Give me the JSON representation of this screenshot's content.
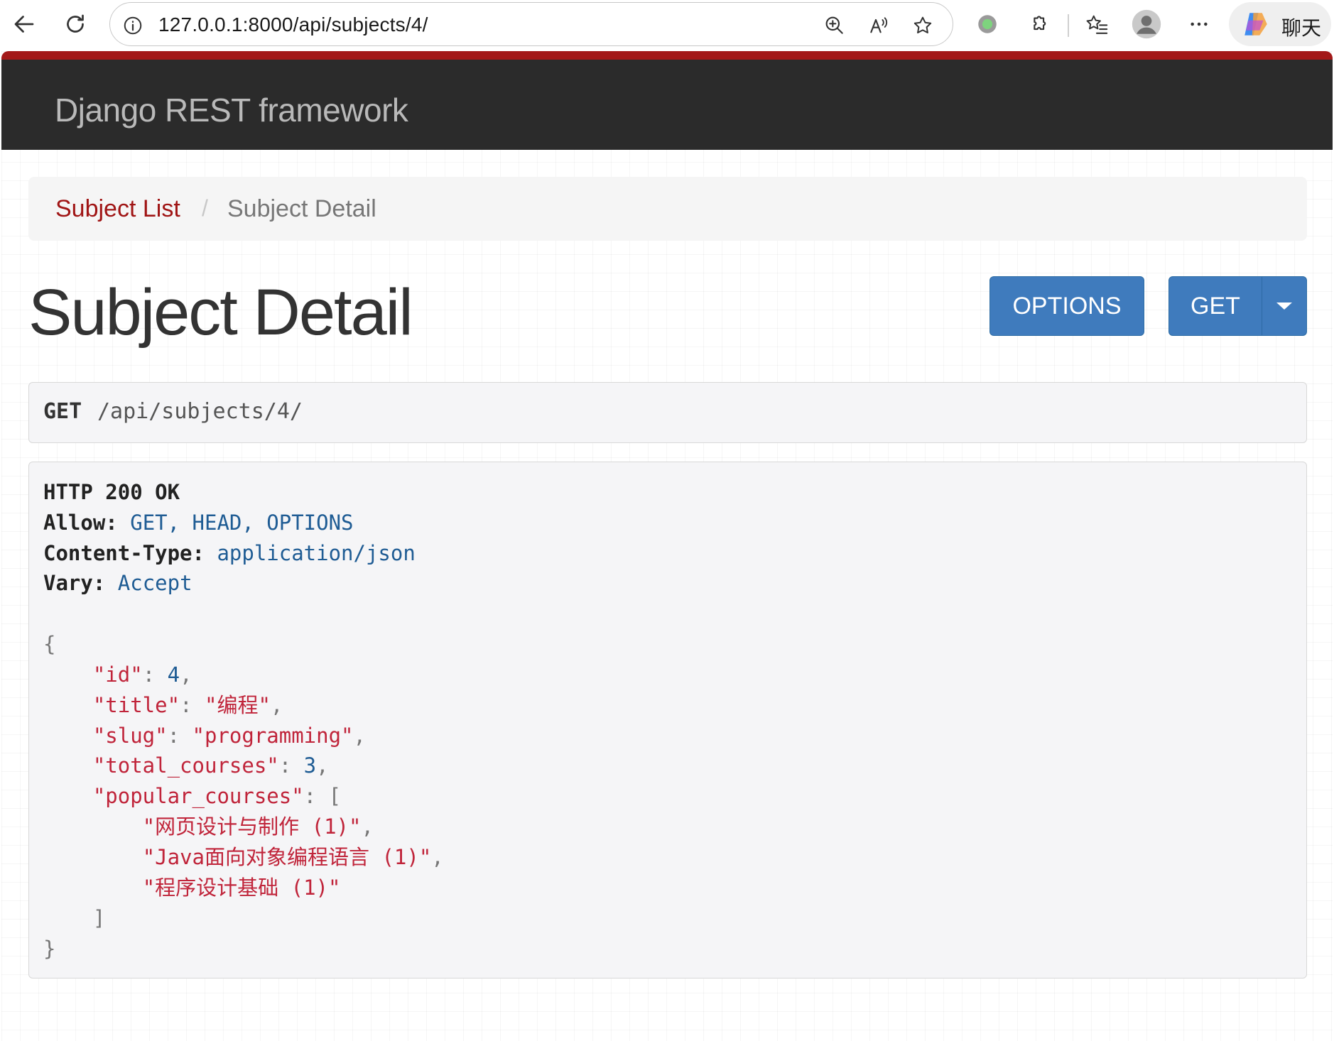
{
  "browser": {
    "url": "127.0.0.1:8000/api/subjects/4/",
    "copilot_label": "聊天"
  },
  "navbar": {
    "brand": "Django REST framework"
  },
  "breadcrumb": {
    "link": "Subject List",
    "separator": "/",
    "active": "Subject Detail"
  },
  "page": {
    "title": "Subject Detail"
  },
  "buttons": {
    "options": "OPTIONS",
    "get": "GET"
  },
  "request": {
    "method": "GET",
    "path": "/api/subjects/4/"
  },
  "response": {
    "status": "HTTP 200 OK",
    "headers": [
      {
        "name": "Allow:",
        "value": "GET, HEAD, OPTIONS"
      },
      {
        "name": "Content-Type:",
        "value": "application/json"
      },
      {
        "name": "Vary:",
        "value": "Accept"
      }
    ],
    "body": {
      "id_key": "\"id\"",
      "id_val": "4",
      "title_key": "\"title\"",
      "title_val": "\"编程\"",
      "slug_key": "\"slug\"",
      "slug_val": "\"programming\"",
      "total_key": "\"total_courses\"",
      "total_val": "3",
      "popular_key": "\"popular_courses\"",
      "popular": [
        "\"网页设计与制作 (1)\"",
        "\"Java面向对象编程语言 (1)\"",
        "\"程序设计基础 (1)\""
      ]
    }
  },
  "colors": {
    "navbar_bg": "#2b2b2b",
    "accent_red": "#a31919",
    "button_blue": "#3f7bbd",
    "link": "#a01515"
  }
}
